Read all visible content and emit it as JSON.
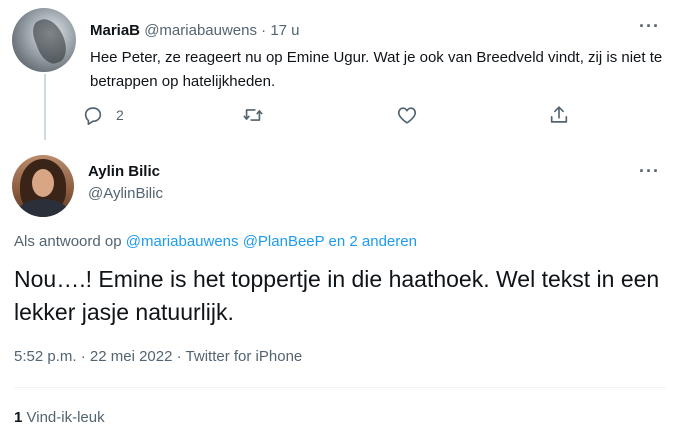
{
  "reply_tweet": {
    "display_name": "MariaB",
    "handle": "@mariabauwens",
    "separator": "·",
    "time_ago": "17 u",
    "text": "Hee Peter, ze reageert nu op Emine Ugur. Wat je ook van Breedveld vindt, zij is niet te betrappen op hatelijkheden.",
    "more_icon": "more-horizontal-icon",
    "actions": {
      "reply_count": "2",
      "reply_icon": "reply-bubble-icon",
      "retweet_icon": "retweet-icon",
      "like_icon": "heart-icon",
      "share_icon": "share-icon"
    }
  },
  "main_tweet": {
    "display_name": "Aylin Bilic",
    "handle": "@AylinBilic",
    "replying_prefix": "Als antwoord op",
    "replying_users": "@mariabauwens @PlanBeeP",
    "replying_others": "en 2 anderen",
    "text": "Nou….! Emine is het toppertje in die haathoek. Wel tekst in een lekker jasje natuurlijk.",
    "time": "5:52 p.m.",
    "date": "22 mei 2022",
    "source": "Twitter for iPhone",
    "meta_separator": "·",
    "like_count": "1",
    "like_label": "Vind-ik-leuk"
  },
  "colors": {
    "text_primary": "#0f1419",
    "text_secondary": "#536471",
    "link": "#1d9bf0",
    "divider": "#eff3f4"
  }
}
